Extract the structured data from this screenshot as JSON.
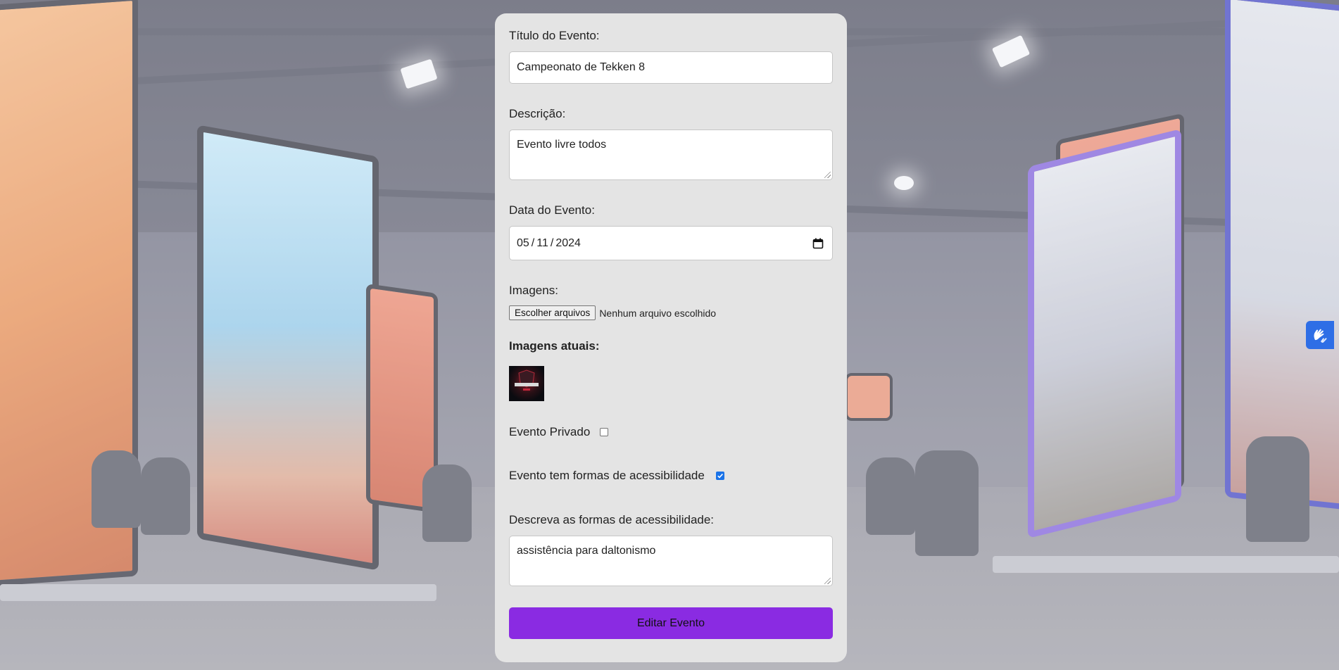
{
  "form": {
    "title_label": "Título do Evento:",
    "title_value": "Campeonato de Tekken 8",
    "description_label": "Descrição:",
    "description_value": "Evento livre todos",
    "date_label": "Data do Evento:",
    "date_day": "05",
    "date_month": "11",
    "date_year": "2024",
    "images_label": "Imagens:",
    "file_button_label": "Escolher arquivos",
    "file_status": "Nenhum arquivo escolhido",
    "current_images_label": "Imagens atuais:",
    "private_label": "Evento Privado",
    "private_checked": false,
    "accessibility_label": "Evento tem formas de acessibilidade",
    "accessibility_checked": true,
    "accessibility_desc_label": "Descreva as formas de acessibilidade:",
    "accessibility_desc_value": "assistência para daltonismo",
    "submit_label": "Editar Evento"
  },
  "icons": {
    "calendar": "calendar-icon",
    "thumbnail": "event-thumbnail",
    "accessibility_widget": "sign-language-icon"
  },
  "colors": {
    "card_background": "#e4e4e4",
    "submit_button": "#8a2be2",
    "checkbox_checked": "#1a73e8",
    "accessibility_widget": "#2e6ee6"
  }
}
